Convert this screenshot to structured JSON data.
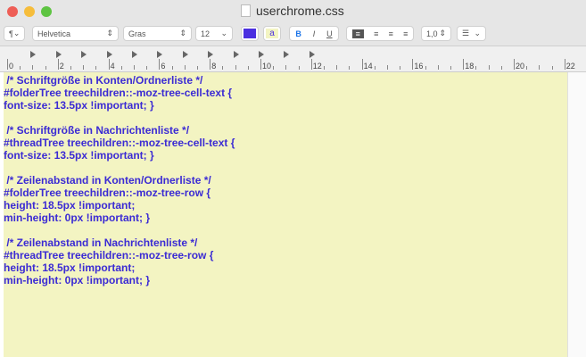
{
  "window": {
    "title": "userchrome.css"
  },
  "toolbar": {
    "paragraph": "¶",
    "font_family": "Helvetica",
    "font_style": "Gras",
    "font_size": "12",
    "text_color": "#4b2fe0",
    "highlight_label": "a",
    "bold": "B",
    "italic": "I",
    "underline": "U",
    "line_spacing": "1,0",
    "list_icon": "list-icon"
  },
  "ruler": {
    "labels": [
      "0",
      "2",
      "4",
      "6",
      "8",
      "10",
      "12",
      "14",
      "16",
      "18",
      "20",
      "22"
    ]
  },
  "editor": {
    "lines": [
      " /* Schriftgröße in Konten/Ordnerliste */",
      "#folderTree treechildren::-moz-tree-cell-text {",
      "font-size: 13.5px !important; }",
      "",
      " /* Schriftgröße in Nachrichtenliste */",
      "#threadTree treechildren::-moz-tree-cell-text {",
      "font-size: 13.5px !important; }",
      "",
      " /* Zeilenabstand in Konten/Ordnerliste */",
      "#folderTree treechildren::-moz-tree-row {",
      "height: 18.5px !important;",
      "min-height: 0px !important; }",
      "",
      " /* Zeilenabstand in Nachrichtenliste */",
      "#threadTree treechildren::-moz-tree-row {",
      "height: 18.5px !important;",
      "min-height: 0px !important; }"
    ]
  }
}
